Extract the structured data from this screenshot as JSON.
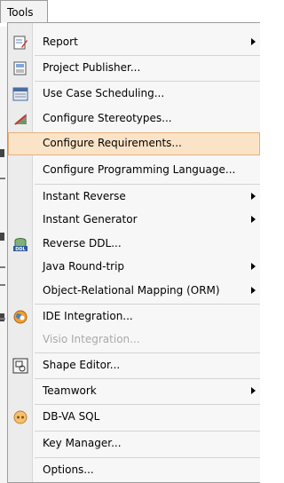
{
  "menubar": {
    "title": "Tools"
  },
  "menu": {
    "items": [
      {
        "label": "Report",
        "submenu": true,
        "icon": "report-icon"
      },
      {
        "label": "Project Publisher...",
        "icon": "project-publisher-icon"
      },
      {
        "label": "Use Case Scheduling...",
        "icon": "use-case-scheduling-icon"
      },
      {
        "label": "Configure Stereotypes...",
        "icon": "configure-stereotypes-icon"
      },
      {
        "label": "Configure Requirements...",
        "highlighted": true
      },
      {
        "label": "Configure Programming Language..."
      },
      {
        "label": "Instant Reverse",
        "submenu": true
      },
      {
        "label": "Instant Generator",
        "submenu": true
      },
      {
        "label": "Reverse DDL...",
        "icon": "reverse-ddl-icon"
      },
      {
        "label": "Java Round-trip",
        "submenu": true
      },
      {
        "label": "Object-Relational Mapping (ORM)",
        "submenu": true
      },
      {
        "label": "IDE Integration...",
        "icon": "ide-integration-icon"
      },
      {
        "label": "Visio Integration...",
        "disabled": true
      },
      {
        "label": "Shape Editor...",
        "icon": "shape-editor-icon"
      },
      {
        "label": "Teamwork",
        "submenu": true
      },
      {
        "label": "DB-VA SQL",
        "icon": "db-va-sql-icon"
      },
      {
        "label": "Key Manager..."
      },
      {
        "label": "Options..."
      }
    ]
  },
  "colors": {
    "highlight": "#fbe3c7",
    "highlight_border": "#e6b079",
    "disabled_text": "#a9a9a9"
  }
}
